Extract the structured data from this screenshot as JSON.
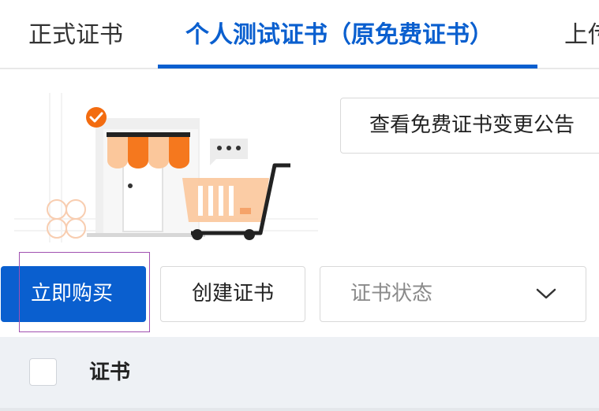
{
  "tabs": [
    {
      "label": "正式证书",
      "active": false
    },
    {
      "label": "个人测试证书（原免费证书）",
      "active": true
    },
    {
      "label": "上传",
      "active": false
    }
  ],
  "notice_button": {
    "label": "查看免费证书变更公告"
  },
  "actions": {
    "buy_label": "立即购买",
    "create_label": "创建证书"
  },
  "status_filter": {
    "placeholder": "证书状态"
  },
  "table": {
    "columns": [
      "证书"
    ]
  },
  "colors": {
    "accent": "#0a5fcf",
    "awning_orange": "#f5781e",
    "awning_light": "#fbc79b",
    "check_badge": "#f36c10"
  },
  "icons": {
    "chevron": "chevron-down-icon",
    "badge": "checkmark-badge-icon"
  }
}
